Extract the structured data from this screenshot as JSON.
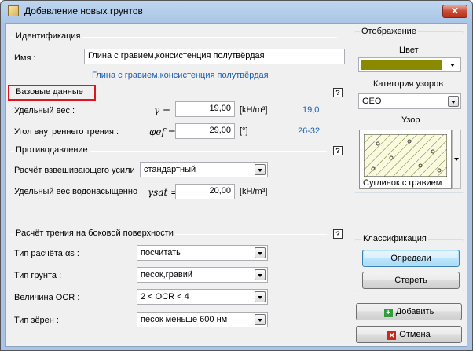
{
  "window": {
    "title": "Добавление новых грунтов",
    "close_glyph": "✕"
  },
  "identification": {
    "section_title": "Идентификация",
    "name_label": "Имя :",
    "name_value": "Глина с гравием,консистенция полутвёрдая",
    "name_hint": "Глина с гравием,консистенция полутвёрдая"
  },
  "basic": {
    "section_title": "Базовые данные",
    "unit_weight_label": "Удельный вес :",
    "unit_weight_symbol": "γ =",
    "unit_weight_value": "19,00",
    "unit_weight_unit": "[kH/m³]",
    "unit_weight_hint": "19,0",
    "friction_label": "Угол внутреннего трения :",
    "friction_symbol": "φef =",
    "friction_value": "29,00",
    "friction_unit": "[°]",
    "friction_hint": "26-32"
  },
  "uplift": {
    "section_title": "Противодавление",
    "calc_label": "Расчёт взвешивающего усили",
    "calc_value": "стандартный",
    "sat_label": "Удельный вес водонасыщенно",
    "sat_symbol": "γsat =",
    "sat_value": "20,00",
    "sat_unit": "[kH/m³]"
  },
  "skin": {
    "section_title": "Расчёт трения на  боковой поверхности",
    "alpha_label": "Тип расчёта αs :",
    "alpha_value": "посчитать",
    "soil_type_label": "Тип грунта :",
    "soil_type_value": "песок,гравий",
    "ocr_label": "Величина OCR :",
    "ocr_value": "2 < OCR < 4",
    "grain_label": "Тип зёрен :",
    "grain_value": "песок меньше 600 нм"
  },
  "display": {
    "section_title": "Отображение",
    "color_label": "Цвет",
    "color_value": "#8a8a00",
    "pattern_category_label": "Категория узоров",
    "pattern_category_value": "GEO",
    "pattern_label": "Узор",
    "pattern_name": "Суглинок с гравием"
  },
  "classification": {
    "section_title": "Классификация",
    "classify_button": "Определи",
    "clear_button": "Стереть"
  },
  "actions": {
    "add_button": "Добавить",
    "cancel_button": "Отмена"
  },
  "help_glyph": "?"
}
